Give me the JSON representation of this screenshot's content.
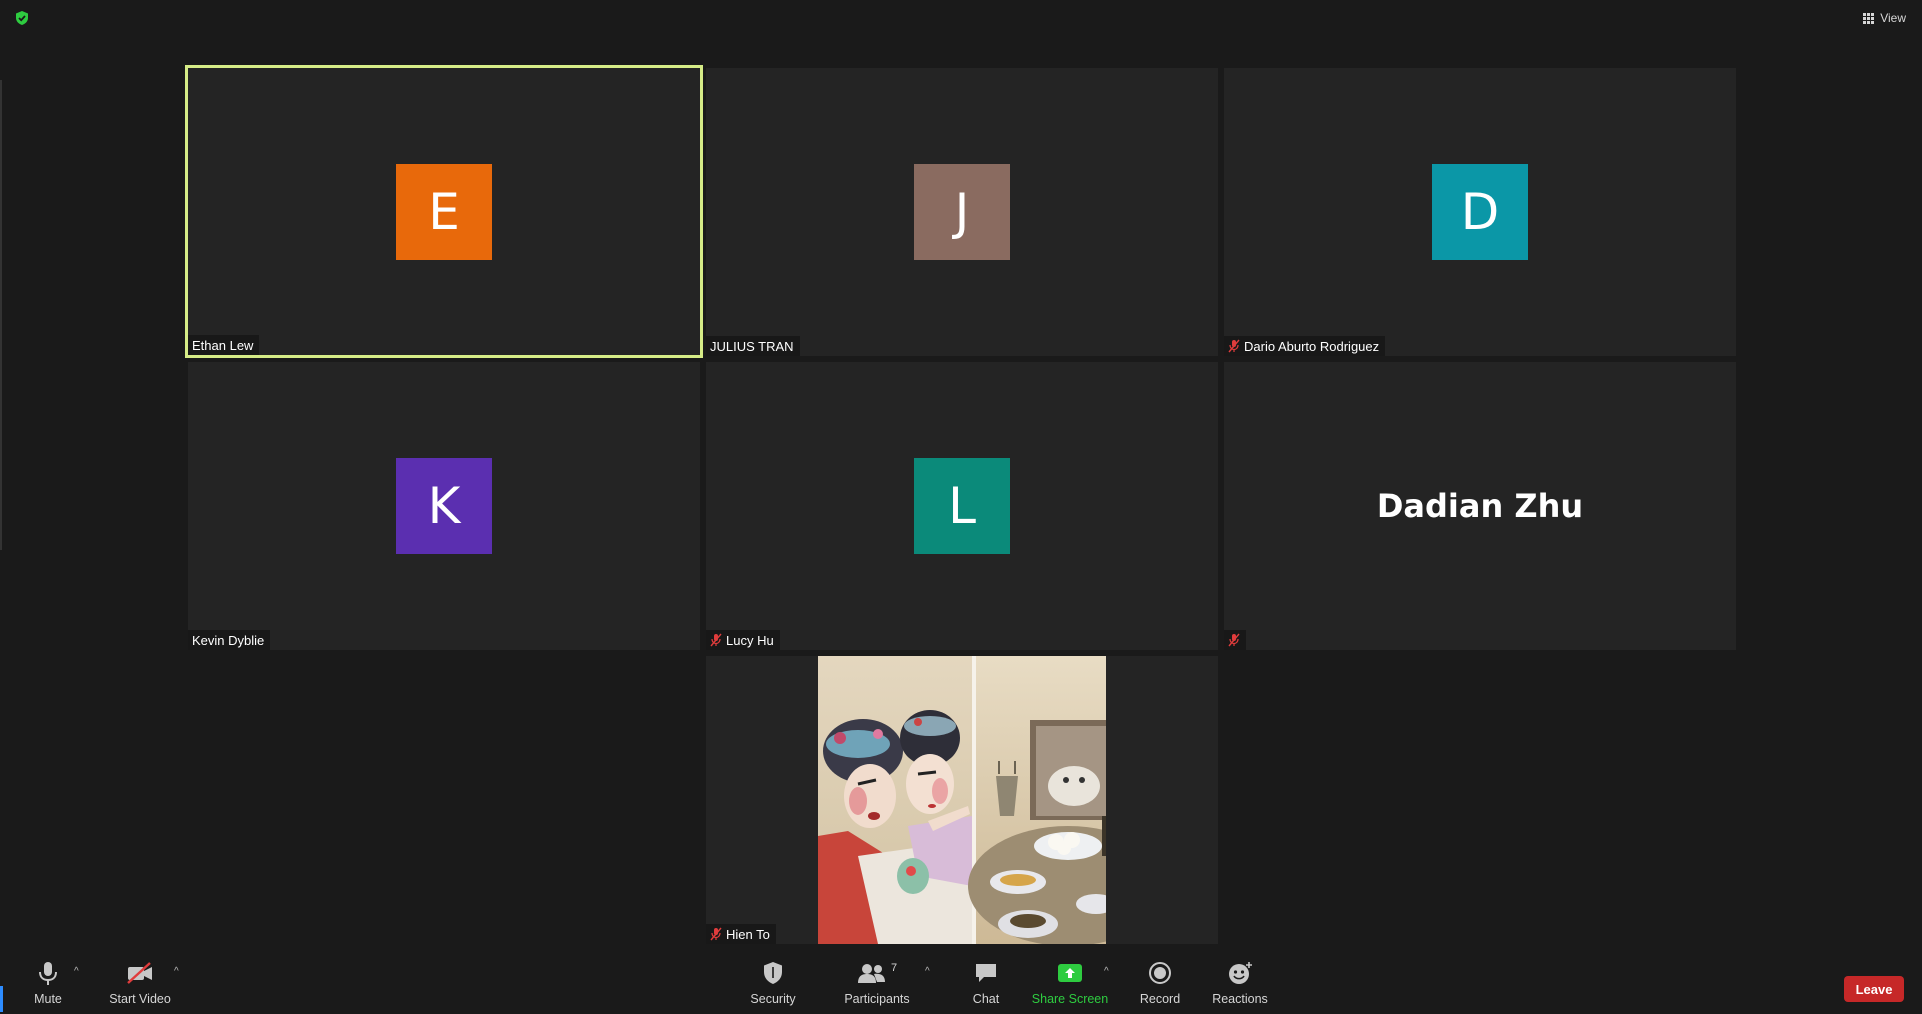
{
  "header": {
    "view_label": "View",
    "security_color": "#2ecc40"
  },
  "tiles": [
    {
      "initial": "E",
      "name": "Ethan Lew",
      "color": "#e8690b",
      "muted": false,
      "active": true
    },
    {
      "initial": "J",
      "name": "JULIUS TRAN",
      "color": "#8a6b60",
      "muted": false,
      "active": false
    },
    {
      "initial": "D",
      "name": "Dario Aburto Rodriguez",
      "color": "#0b97a7",
      "muted": true,
      "active": false
    },
    {
      "initial": "K",
      "name": "Kevin Dyblie",
      "color": "#5b2fb0",
      "muted": false,
      "active": false
    },
    {
      "initial": "L",
      "name": "Lucy Hu",
      "color": "#0b8a7a",
      "muted": true,
      "active": false
    },
    {
      "big_name": "Dadian Zhu",
      "name": "",
      "muted": true,
      "active": false
    },
    {
      "name": "Hien To",
      "muted": true,
      "active": false,
      "has_video": true
    }
  ],
  "toolbar": {
    "mute_label": "Mute",
    "video_label": "Start Video",
    "security_label": "Security",
    "participants_label": "Participants",
    "participants_count": "7",
    "chat_label": "Chat",
    "share_label": "Share Screen",
    "record_label": "Record",
    "reactions_label": "Reactions",
    "leave_label": "Leave"
  }
}
